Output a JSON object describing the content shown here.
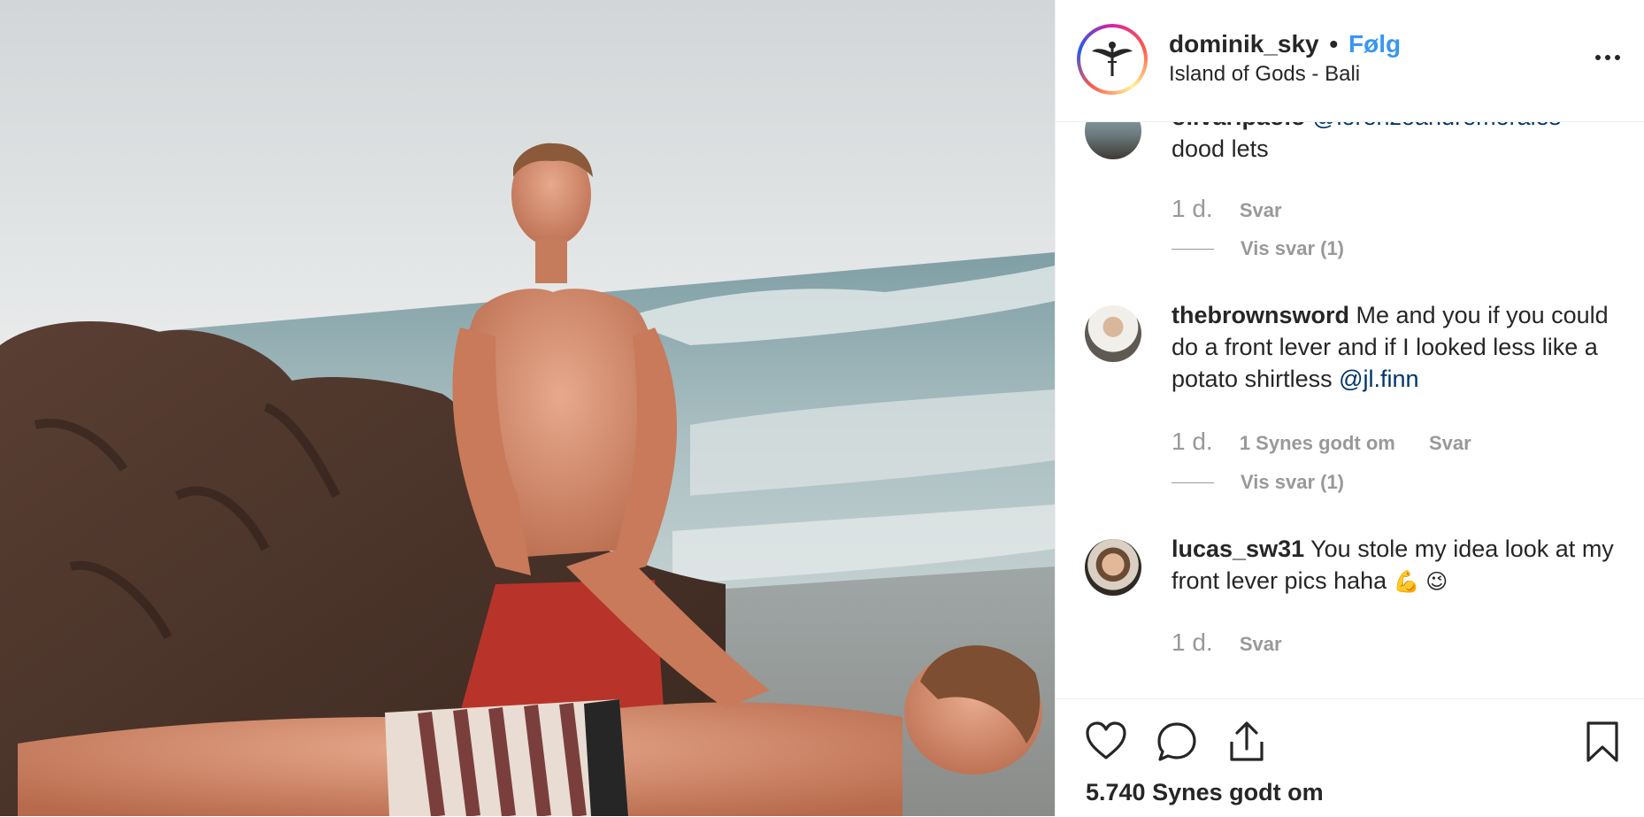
{
  "header": {
    "username": "dominik_sky",
    "separator": "•",
    "follow_label": "Følg",
    "location": "Island of Gods - Bali"
  },
  "comments": [
    {
      "username": "olivaripaolo",
      "mention": "@lorenzoandremorales",
      "text": "dood lets",
      "time": "1 d.",
      "reply_label": "Svar",
      "view_replies": "Vis svar (1)"
    },
    {
      "username": "thebrownsword",
      "text": "Me and you if you could do a front lever and if I looked less like a potato shirtless",
      "mention": "@jl.finn",
      "time": "1 d.",
      "likes_label": "1 Synes godt om",
      "reply_label": "Svar",
      "view_replies": "Vis svar (1)"
    },
    {
      "username": "lucas_sw31",
      "text": "You stole my idea look at my front lever pics haha",
      "emojis": "💪 😉",
      "time": "1 d.",
      "reply_label": "Svar"
    }
  ],
  "actions": {
    "icons": [
      "heart-icon",
      "comment-icon",
      "share-icon",
      "bookmark-icon"
    ]
  },
  "likes_count": "5.740 Synes godt om",
  "colors": {
    "follow": "#3897f0",
    "mention": "#003569",
    "meta": "#999999",
    "text": "#262626"
  }
}
